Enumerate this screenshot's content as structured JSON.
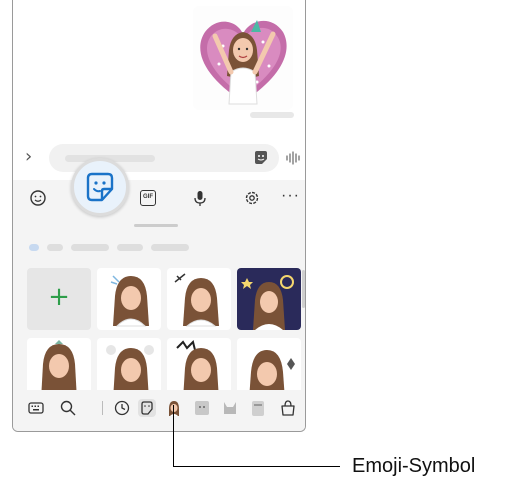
{
  "callout": {
    "label": "Emoji-Symbol"
  },
  "toolbar": {
    "gif_label": "GIF",
    "more_label": "···"
  },
  "grid": {
    "add_label": "+"
  },
  "input": {
    "expand_label": "›"
  },
  "icons": {
    "emoji": "smiley-icon",
    "sticker": "sticker-icon",
    "gif": "gif-icon",
    "mic": "microphone-icon",
    "settings": "gear-icon",
    "more": "more-icon",
    "keyboard": "keyboard-icon",
    "search": "search-icon",
    "recent": "clock-icon",
    "sticker_tab": "sticker-tab-icon",
    "avatar": "avatar-icon",
    "store": "shopping-bag-icon"
  },
  "colors": {
    "accent": "#1a73c8",
    "add_green": "#2e9e4a",
    "keyboard_bg": "#f4f4f4"
  }
}
